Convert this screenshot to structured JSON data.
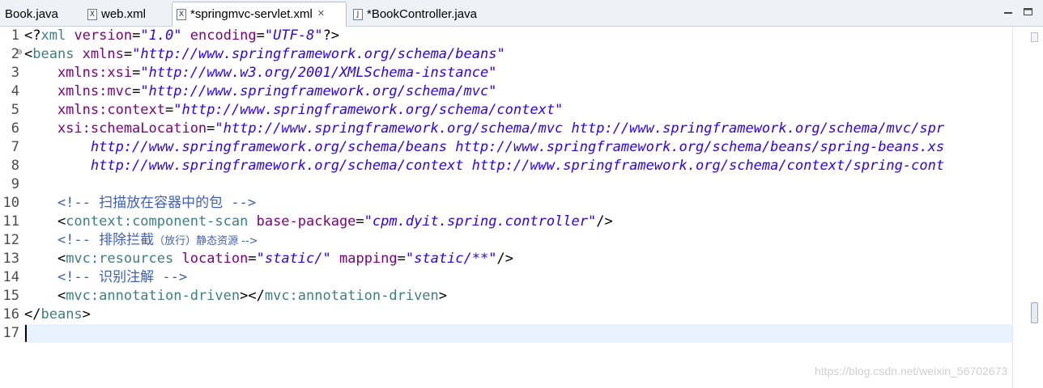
{
  "tabs": [
    {
      "label": "Book.java",
      "icon": "java-file-icon",
      "icon_glyph": "J",
      "active": false
    },
    {
      "label": "web.xml",
      "icon": "xml-file-icon",
      "icon_glyph": "X",
      "active": false
    },
    {
      "label": "*springmvc-servlet.xml",
      "icon": "xml-file-icon",
      "icon_glyph": "X",
      "active": true
    },
    {
      "label": "*BookController.java",
      "icon": "java-file-icon",
      "icon_glyph": "J",
      "active": false
    }
  ],
  "close_glyph": "✕",
  "window_buttons": {
    "minimize": "minimize-icon",
    "maximize": "maximize-icon"
  },
  "line_numbers": [
    "1",
    "2",
    "3",
    "4",
    "5",
    "6",
    "7",
    "8",
    "9",
    "10",
    "11",
    "12",
    "13",
    "14",
    "15",
    "16",
    "17"
  ],
  "code_lines": [
    [
      {
        "t": "plain",
        "s": "<?"
      },
      {
        "t": "tag",
        "s": "xml"
      },
      {
        "t": "attr",
        "s": " version"
      },
      {
        "t": "plain",
        "s": "="
      },
      {
        "t": "val",
        "s": "\"1.0\""
      },
      {
        "t": "attr",
        "s": " encoding"
      },
      {
        "t": "plain",
        "s": "="
      },
      {
        "t": "val",
        "s": "\"UTF-8\""
      },
      {
        "t": "plain",
        "s": "?>"
      }
    ],
    [
      {
        "t": "plain",
        "s": "<"
      },
      {
        "t": "tag",
        "s": "beans"
      },
      {
        "t": "attr",
        "s": " xmlns"
      },
      {
        "t": "plain",
        "s": "="
      },
      {
        "t": "val",
        "s": "\"http://www.springframework.org/schema/beans\""
      }
    ],
    [
      {
        "t": "attr",
        "s": "    xmlns:xsi"
      },
      {
        "t": "plain",
        "s": "="
      },
      {
        "t": "val",
        "s": "\"http://www.w3.org/2001/XMLSchema-instance\""
      }
    ],
    [
      {
        "t": "attr",
        "s": "    xmlns:mvc"
      },
      {
        "t": "plain",
        "s": "="
      },
      {
        "t": "val",
        "s": "\"http://www.springframework.org/schema/mvc\""
      }
    ],
    [
      {
        "t": "attr",
        "s": "    xmlns:context"
      },
      {
        "t": "plain",
        "s": "="
      },
      {
        "t": "val",
        "s": "\"http://www.springframework.org/schema/context\""
      }
    ],
    [
      {
        "t": "attr",
        "s": "    xsi:schemaLocation"
      },
      {
        "t": "plain",
        "s": "="
      },
      {
        "t": "val",
        "s": "\"http://www.springframework.org/schema/mvc http://www.springframework.org/schema/mvc/spr"
      }
    ],
    [
      {
        "t": "val",
        "s": "        http://www.springframework.org/schema/beans http://www.springframework.org/schema/beans/spring-beans.xs"
      }
    ],
    [
      {
        "t": "val",
        "s": "        http://www.springframework.org/schema/context http://www.springframework.org/schema/context/spring-cont"
      }
    ],
    [],
    [
      {
        "t": "cmt",
        "s": "    <!-- "
      },
      {
        "t": "cmt-cjk",
        "s": "扫描放在容器中的包"
      },
      {
        "t": "cmt",
        "s": " -->"
      }
    ],
    [
      {
        "t": "plain",
        "s": "    <"
      },
      {
        "t": "tag",
        "s": "context:component-scan"
      },
      {
        "t": "attr",
        "s": " base-package"
      },
      {
        "t": "plain",
        "s": "="
      },
      {
        "t": "val",
        "s": "\"cpm.dyit.spring.controller\""
      },
      {
        "t": "plain",
        "s": "/>"
      }
    ],
    [
      {
        "t": "cmt",
        "s": "    <!-- "
      },
      {
        "t": "cmt-cjk",
        "s": "排除拦截"
      },
      {
        "t": "cmt-cjk-small",
        "s": "（放行）静态资源 -->"
      }
    ],
    [
      {
        "t": "plain",
        "s": "    <"
      },
      {
        "t": "tag",
        "s": "mvc:resources"
      },
      {
        "t": "attr",
        "s": " location"
      },
      {
        "t": "plain",
        "s": "="
      },
      {
        "t": "val",
        "s": "\"static/\""
      },
      {
        "t": "attr",
        "s": " mapping"
      },
      {
        "t": "plain",
        "s": "="
      },
      {
        "t": "val",
        "s": "\"static/**\""
      },
      {
        "t": "plain",
        "s": "/>"
      }
    ],
    [
      {
        "t": "cmt",
        "s": "    <!-- "
      },
      {
        "t": "cmt-cjk",
        "s": "识别注解"
      },
      {
        "t": "cmt",
        "s": " -->"
      }
    ],
    [
      {
        "t": "plain",
        "s": "    <"
      },
      {
        "t": "tag",
        "s": "mvc:annotation-driven"
      },
      {
        "t": "plain",
        "s": "></"
      },
      {
        "t": "tag",
        "s": "mvc:annotation-driven"
      },
      {
        "t": "plain",
        "s": ">"
      }
    ],
    [
      {
        "t": "plain",
        "s": "</"
      },
      {
        "t": "tag",
        "s": "beans"
      },
      {
        "t": "plain",
        "s": ">"
      }
    ],
    []
  ],
  "current_line": 17,
  "fold_marker": "⊖",
  "watermark": "https://blog.csdn.net/weixin_56702673"
}
